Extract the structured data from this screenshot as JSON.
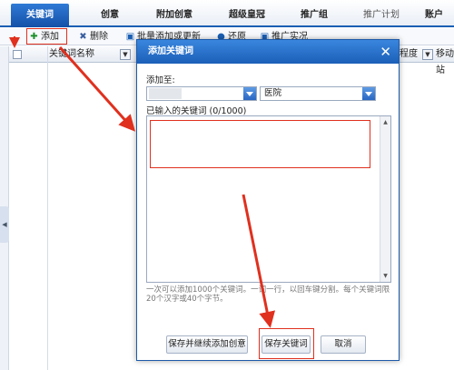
{
  "tabs": [
    {
      "label": "关键词",
      "active": true
    },
    {
      "label": "创意",
      "active": false
    },
    {
      "label": "附加创意",
      "active": false
    },
    {
      "label": "超级皇冠",
      "active": false
    },
    {
      "label": "推广组",
      "active": false
    },
    {
      "label": "推广计划",
      "active": false
    },
    {
      "label": "账户",
      "active": false
    }
  ],
  "toolbar": {
    "add_label": "添加",
    "delete_label": "删除",
    "batch_label": "批量添加或更新",
    "restore_label": "还原",
    "report_label": "推广实况"
  },
  "grid": {
    "col_name": "关键词名称",
    "col_degree": "程度",
    "col_mobile": "移动站"
  },
  "dialog": {
    "title": "添加关键词",
    "add_to_label": "添加至:",
    "group_select_value": "医院",
    "entered_label": "已输入的关键词 (0/1000)",
    "hint": "一次可以添加1000个关键词。一词一行，以回车键分割。每个关键词限20个汉字或40个字节。",
    "btn_save_continue": "保存并继续添加创意",
    "btn_save": "保存关键词",
    "btn_cancel": "取消"
  },
  "colors": {
    "accent": "#1b5fb8",
    "annotation": "#e0301e"
  }
}
